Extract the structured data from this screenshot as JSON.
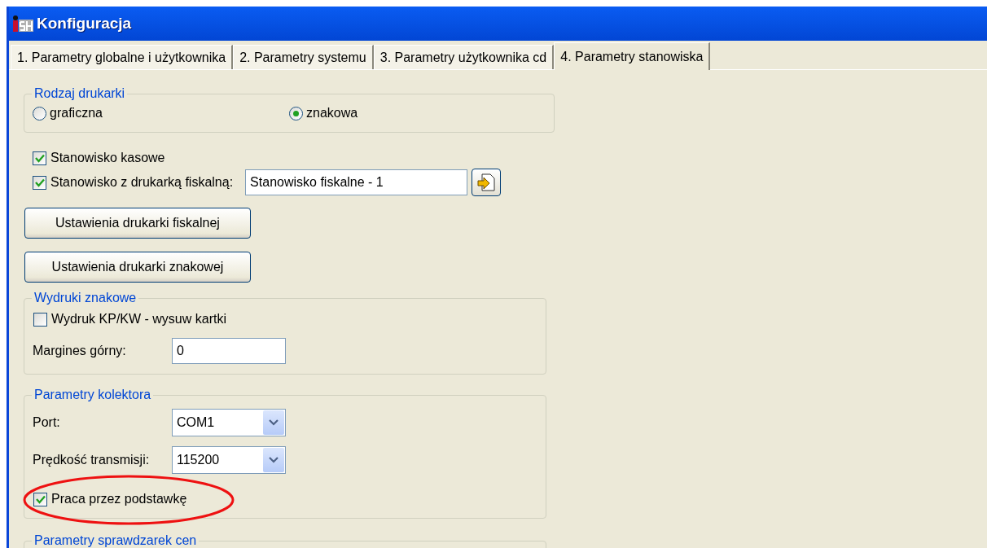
{
  "window": {
    "title": "Konfiguracja"
  },
  "tabs": [
    {
      "label": "1. Parametry globalne i użytkownika",
      "selected": false
    },
    {
      "label": "2. Parametry systemu",
      "selected": false
    },
    {
      "label": "3. Parametry użytkownika cd",
      "selected": false
    },
    {
      "label": "4. Parametry stanowiska",
      "selected": true
    }
  ],
  "printer_type": {
    "title": "Rodzaj drukarki",
    "options": [
      {
        "label": "graficzna",
        "selected": false
      },
      {
        "label": "znakowa",
        "selected": true
      }
    ]
  },
  "station": {
    "cash_register": {
      "label": "Stanowisko kasowe",
      "checked": true
    },
    "fiscal": {
      "label": "Stanowisko z drukarką fiskalną:",
      "checked": true,
      "value": "Stanowisko fiskalne - 1"
    }
  },
  "buttons": [
    "Ustawienia drukarki fiskalnej",
    "Ustawienia drukarki znakowej"
  ],
  "char_printouts": {
    "title": "Wydruki znakowe",
    "checkbox": {
      "label": "Wydruk KP/KW - wysuw kartki",
      "checked": false
    },
    "top_margin": {
      "label": "Margines górny:",
      "value": "0"
    }
  },
  "collector": {
    "title": "Parametry kolektora",
    "port": {
      "label": "Port:",
      "value": "COM1"
    },
    "speed": {
      "label": "Prędkość transmisji:",
      "value": "115200"
    },
    "dock": {
      "label": "Praca przez podstawkę",
      "checked": true,
      "highlighted": true
    }
  },
  "price_checkers": {
    "title": "Parametry sprawdzarek cen"
  }
}
